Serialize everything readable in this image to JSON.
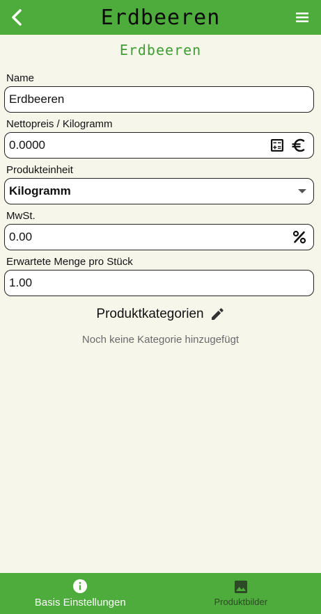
{
  "appbar": {
    "title": "Erdbeeren",
    "back_icon": "chevron-left-icon",
    "menu_icon": "hamburger-menu-icon"
  },
  "page_title": "Erdbeeren",
  "form": {
    "name": {
      "label": "Name",
      "value": "Erdbeeren"
    },
    "net_price": {
      "label": "Nettopreis / Kilogramm",
      "value": "0.0000",
      "icons": [
        "calculator-icon",
        "euro-icon"
      ]
    },
    "unit": {
      "label": "Produkteinheit",
      "value": "Kilogramm",
      "icon": "dropdown-arrow-icon"
    },
    "vat": {
      "label": "MwSt.",
      "value": "0.00",
      "icon": "percent-icon"
    },
    "expected_quantity": {
      "label": "Erwartete Menge pro Stück",
      "value": "1.00"
    }
  },
  "categories": {
    "title": "Produktkategorien",
    "edit_icon": "pencil-icon",
    "empty_text": "Noch keine Kategorie hinzugefügt"
  },
  "bottom_nav": {
    "tabs": [
      {
        "label": "Basis Einstellungen",
        "icon": "info-icon",
        "active": true
      },
      {
        "label": "Produktbilder",
        "icon": "image-icon",
        "active": false
      }
    ]
  },
  "colors": {
    "brand_green": "#4eac3c",
    "title_green": "#3e9e33",
    "background": "#f6f6ea"
  }
}
